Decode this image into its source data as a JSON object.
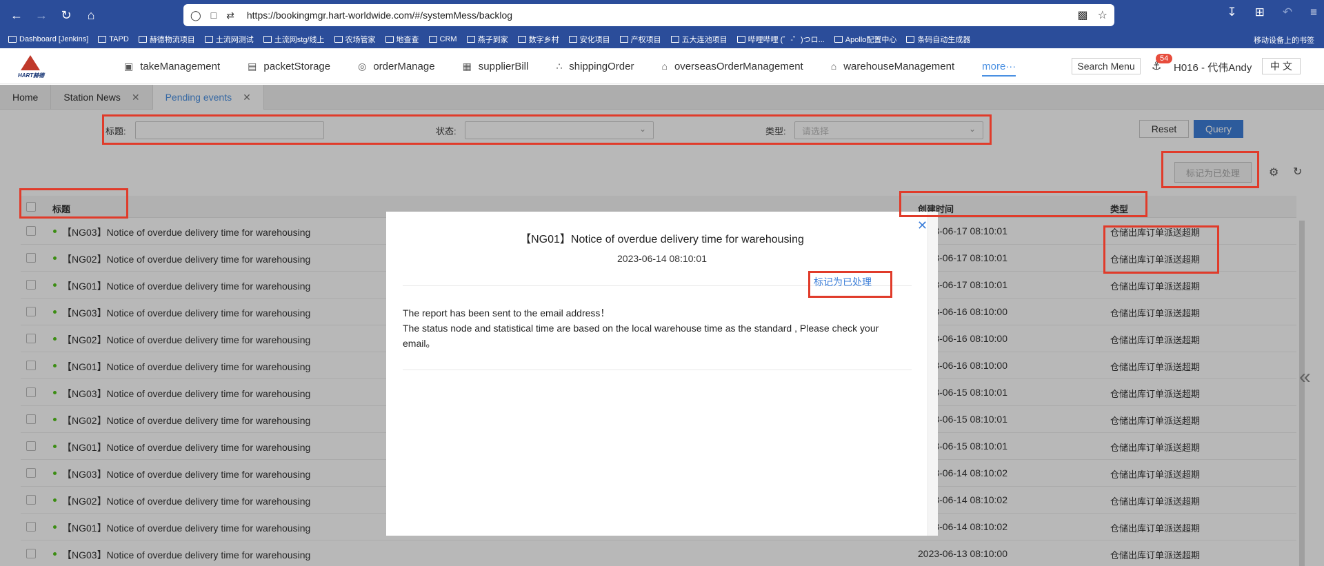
{
  "browser": {
    "url_host": "https://bookingmgr.hart-worldwide.com",
    "url_path": "/#/systemMess/backlog",
    "bookmarks": [
      "Dashboard [Jenkins]",
      "TAPD",
      "赫德物流项目",
      "土流网测试",
      "土流网stg/线上",
      "农场管家",
      "地查查",
      "CRM",
      "燕子到家",
      "数字乡村",
      "安化项目",
      "产权项目",
      "五大连池项目",
      "哔哩哔哩 (゜-゜)つロ...",
      "Apollo配置中心",
      "条码自动生成器"
    ],
    "mobile_bookmarks": "移动设备上的书签"
  },
  "header": {
    "logo_text": "HART赫德",
    "nav": [
      {
        "label": "takeManagement",
        "icon": "car-icon"
      },
      {
        "label": "packetStorage",
        "icon": "box-icon"
      },
      {
        "label": "orderManage",
        "icon": "globe-icon"
      },
      {
        "label": "supplierBill",
        "icon": "bill-icon"
      },
      {
        "label": "shippingOrder",
        "icon": "network-icon"
      },
      {
        "label": "overseasOrderManagement",
        "icon": "home-outline-icon"
      },
      {
        "label": "warehouseManagement",
        "icon": "home-icon"
      }
    ],
    "more": "more···",
    "search_menu": "Search Menu",
    "badge_count": "54",
    "user": "H016 - 代伟Andy",
    "lang": "中 文"
  },
  "tabs": [
    {
      "label": "Home",
      "closable": false,
      "active": false
    },
    {
      "label": "Station News",
      "closable": true,
      "active": false
    },
    {
      "label": "Pending events",
      "closable": true,
      "active": true
    }
  ],
  "filters": {
    "title_label": "标题:",
    "status_label": "状态:",
    "type_label": "类型:",
    "type_placeholder": "请选择",
    "reset": "Reset",
    "query": "Query"
  },
  "toolbar": {
    "mark_processed": "标记为已处理"
  },
  "table": {
    "columns": {
      "title": "标题",
      "created": "创建时间",
      "type": "类型"
    },
    "rows": [
      {
        "title": "【NG03】Notice of overdue delivery time for warehousing",
        "time": "2023-06-17 08:10:01",
        "type": "仓储出库订单派送超期"
      },
      {
        "title": "【NG02】Notice of overdue delivery time for warehousing",
        "time": "2023-06-17 08:10:01",
        "type": "仓储出库订单派送超期"
      },
      {
        "title": "【NG01】Notice of overdue delivery time for warehousing",
        "time": "2023-06-17 08:10:01",
        "type": "仓储出库订单派送超期"
      },
      {
        "title": "【NG03】Notice of overdue delivery time for warehousing",
        "time": "2023-06-16 08:10:00",
        "type": "仓储出库订单派送超期"
      },
      {
        "title": "【NG02】Notice of overdue delivery time for warehousing",
        "time": "2023-06-16 08:10:00",
        "type": "仓储出库订单派送超期"
      },
      {
        "title": "【NG01】Notice of overdue delivery time for warehousing",
        "time": "2023-06-16 08:10:00",
        "type": "仓储出库订单派送超期"
      },
      {
        "title": "【NG03】Notice of overdue delivery time for warehousing",
        "time": "2023-06-15 08:10:01",
        "type": "仓储出库订单派送超期"
      },
      {
        "title": "【NG02】Notice of overdue delivery time for warehousing",
        "time": "2023-06-15 08:10:01",
        "type": "仓储出库订单派送超期"
      },
      {
        "title": "【NG01】Notice of overdue delivery time for warehousing",
        "time": "2023-06-15 08:10:01",
        "type": "仓储出库订单派送超期"
      },
      {
        "title": "【NG03】Notice of overdue delivery time for warehousing",
        "time": "2023-06-14 08:10:02",
        "type": "仓储出库订单派送超期"
      },
      {
        "title": "【NG02】Notice of overdue delivery time for warehousing",
        "time": "2023-06-14 08:10:02",
        "type": "仓储出库订单派送超期"
      },
      {
        "title": "【NG01】Notice of overdue delivery time for warehousing",
        "time": "2023-06-14 08:10:02",
        "type": "仓储出库订单派送超期"
      },
      {
        "title": "【NG03】Notice of overdue delivery time for warehousing",
        "time": "2023-06-13 08:10:00",
        "type": "仓储出库订单派送超期"
      }
    ]
  },
  "modal": {
    "title": "【NG01】Notice of overdue delivery time for warehousing",
    "date": "2023-06-14 08:10:01",
    "mark_processed": "标记为已处理",
    "body_line1": "The report has been sent to the email address！",
    "body_line2": "The status node and statistical time are based on the local warehouse time as the standard , Please check your email。"
  },
  "colors": {
    "accent": "#3d7fd9",
    "annotation": "#e03b2a",
    "browser_bar": "#2b4d9a"
  }
}
